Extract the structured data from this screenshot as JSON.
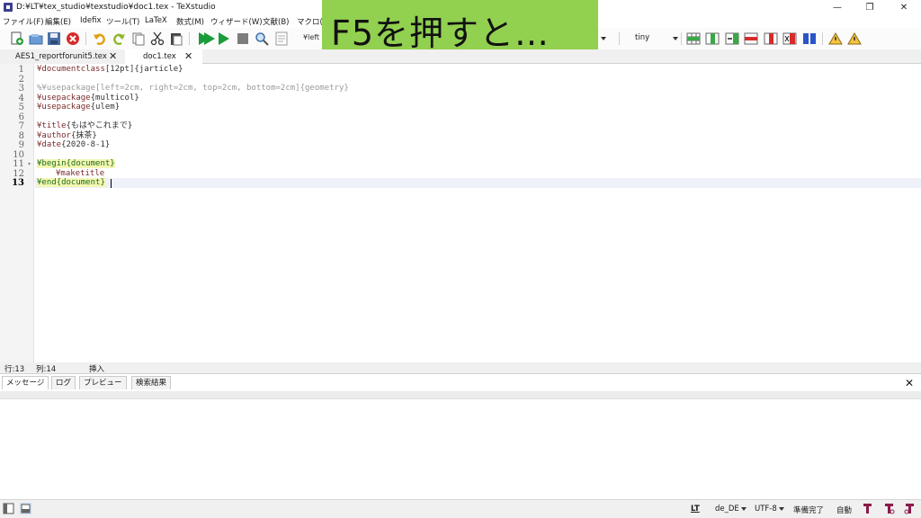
{
  "window": {
    "title": "D:¥LT¥tex_studio¥texstudio¥doc1.tex - TeXstudio",
    "min_glyph": "—",
    "max_glyph": "❐",
    "close_glyph": "✕"
  },
  "menu": [
    "ファイル(F)",
    "編集(E)",
    "Idefix",
    "ツール(T)",
    "LaTeX",
    "数式(M)",
    "ウィザード(W)",
    "文献(B)",
    "マクロ(c"
  ],
  "toolbar": {
    "left_combo": "¥left",
    "size_combo": "tiny"
  },
  "overlay": {
    "text": "F5を押すと…"
  },
  "tabs": [
    {
      "label": "AES1_reportforunit5.tex",
      "close": "✕"
    },
    {
      "label": "doc1.tex",
      "close": "✕"
    }
  ],
  "editor": {
    "line_numbers": [
      "1",
      "2",
      "3",
      "4",
      "5",
      "6",
      "7",
      "8",
      "9",
      "10",
      "11",
      "12",
      "13"
    ],
    "current_line": 13,
    "lines": {
      "l1_cmd": "¥documentclass",
      "l1_arg": "[12pt]{jarticle}",
      "l3_comment": "%¥usepackage[left=2cm, right=2cm, top=2cm, bottom=2cm]{geometry}",
      "l4_cmd": "¥usepackage",
      "l4_arg": "{multicol}",
      "l5_cmd": "¥usepackage",
      "l5_arg": "{ulem}",
      "l7_cmd": "¥title",
      "l7_arg": "{もはやこれまで}",
      "l8_cmd": "¥author",
      "l8_arg": "{抹茶}",
      "l9_cmd": "¥date",
      "l9_arg": "{2020-8-1}",
      "l11_env": "¥begin{document}",
      "l12_cmd": "¥maketitle",
      "l13_env": "¥end{document}"
    }
  },
  "status_line": {
    "row": "行:13",
    "col": "列:14",
    "mode": "挿入"
  },
  "panel": {
    "tabs": [
      "メッセージ",
      "ログ",
      "プレビュー",
      "検索結果"
    ],
    "close": "✕"
  },
  "statusbar": {
    "lt": "LT",
    "language": "de_DE",
    "encoding": "UTF-8",
    "ready": "準備完了",
    "auto": "自動"
  },
  "colors": {
    "overlay": "#92d050",
    "run_green": "#1a9c3a"
  }
}
